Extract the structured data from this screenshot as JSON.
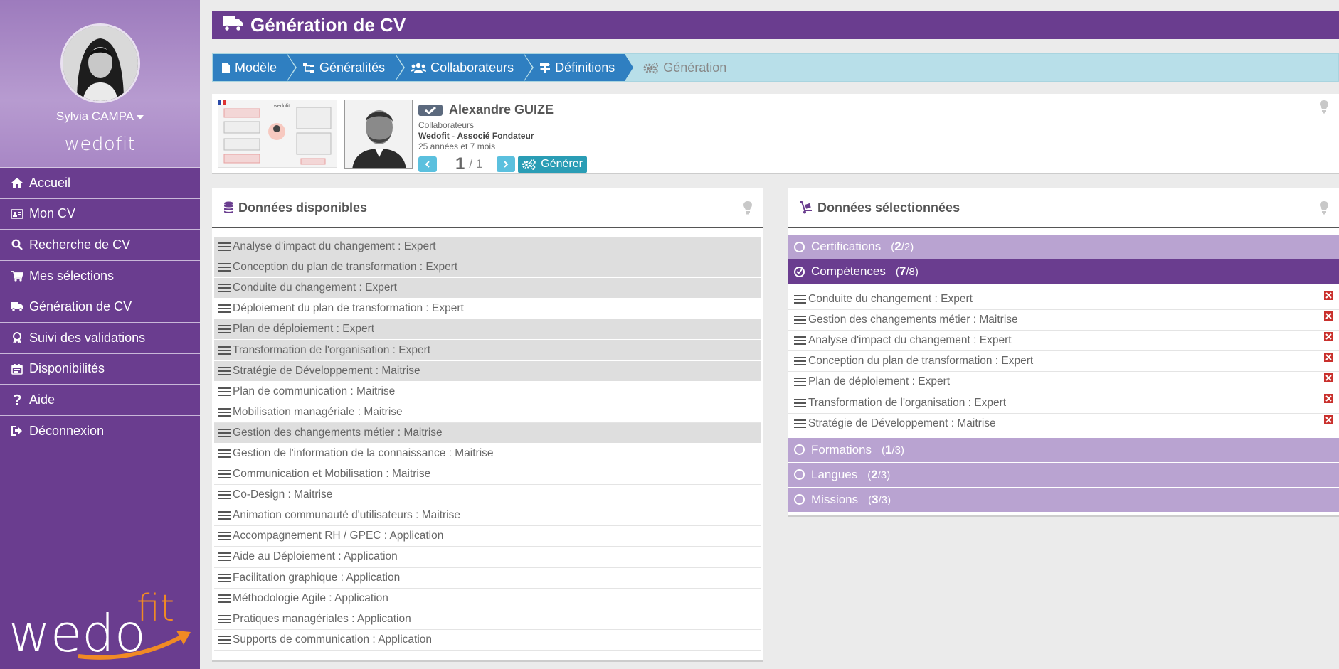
{
  "sidebar": {
    "user_name": "Sylvia CAMPA",
    "small_logo": "wedofit",
    "nav": [
      {
        "label": "Accueil",
        "icon": "home-icon"
      },
      {
        "label": "Mon CV",
        "icon": "id-card-icon"
      },
      {
        "label": "Recherche de CV",
        "icon": "search-icon"
      },
      {
        "label": "Mes sélections",
        "icon": "cart-icon"
      },
      {
        "label": "Génération de CV",
        "icon": "truck-icon"
      },
      {
        "label": "Suivi des validations",
        "icon": "award-icon"
      },
      {
        "label": "Disponibilités",
        "icon": "calendar-icon"
      },
      {
        "label": "Aide",
        "icon": "question-icon"
      },
      {
        "label": "Déconnexion",
        "icon": "sign-out-icon"
      }
    ],
    "logo_left": "wedo",
    "logo_right": "fit"
  },
  "header": {
    "title": "Génération de CV"
  },
  "steps": [
    {
      "label": "Modèle",
      "icon": "file-icon"
    },
    {
      "label": "Généralités",
      "icon": "sitemap-icon"
    },
    {
      "label": "Collaborateurs",
      "icon": "users-icon"
    },
    {
      "label": "Définitions",
      "icon": "signs-icon"
    },
    {
      "label": "Génération",
      "icon": "cogs-icon"
    }
  ],
  "profile": {
    "name": "Alexandre GUIZE",
    "category": "Collaborateurs",
    "company": "Wedofit",
    "separator": " - ",
    "role": "Associé Fondateur",
    "experience": "25 années et 7 mois",
    "page_current": "1",
    "page_total": "/ 1",
    "generate_label": "Générer"
  },
  "available": {
    "title": "Données disponibles",
    "items": [
      {
        "label": "Analyse d'impact du changement : Expert",
        "highlighted": true
      },
      {
        "label": "Conception du plan de transformation : Expert",
        "highlighted": true
      },
      {
        "label": "Conduite du changement : Expert",
        "highlighted": true
      },
      {
        "label": "Déploiement du plan de transformation : Expert",
        "highlighted": false
      },
      {
        "label": "Plan de déploiement : Expert",
        "highlighted": true
      },
      {
        "label": "Transformation de l'organisation : Expert",
        "highlighted": true
      },
      {
        "label": "Stratégie de Développement : Maitrise",
        "highlighted": true
      },
      {
        "label": "Plan de communication : Maitrise",
        "highlighted": false
      },
      {
        "label": "Mobilisation managériale : Maitrise",
        "highlighted": false
      },
      {
        "label": "Gestion des changements métier : Maitrise",
        "highlighted": true
      },
      {
        "label": "Gestion de l'information de la connaissance : Maitrise",
        "highlighted": false
      },
      {
        "label": "Communication et Mobilisation : Maitrise",
        "highlighted": false
      },
      {
        "label": "Co-Design : Maitrise",
        "highlighted": false
      },
      {
        "label": "Animation communauté d'utilisateurs : Maitrise",
        "highlighted": false
      },
      {
        "label": "Accompagnement RH / GPEC : Application",
        "highlighted": false
      },
      {
        "label": "Aide au Déploiement : Application",
        "highlighted": false
      },
      {
        "label": "Facilitation graphique : Application",
        "highlighted": false
      },
      {
        "label": "Méthodologie Agile : Application",
        "highlighted": false
      },
      {
        "label": "Pratiques managériales : Application",
        "highlighted": false
      },
      {
        "label": "Supports de communication : Application",
        "highlighted": false
      }
    ]
  },
  "selected": {
    "title": "Données sélectionnées",
    "sections": {
      "certifications": {
        "label": "Certifications",
        "count": "2",
        "total": "/2"
      },
      "competences": {
        "label": "Compétences",
        "count": "7",
        "total": "/8"
      },
      "formations": {
        "label": "Formations",
        "count": "1",
        "total": "/3"
      },
      "langues": {
        "label": "Langues",
        "count": "2",
        "total": "/3"
      },
      "missions": {
        "label": "Missions",
        "count": "3",
        "total": "/3"
      }
    },
    "competences_items": [
      "Conduite du changement : Expert",
      "Gestion des changements métier : Maitrise",
      "Analyse d'impact du changement : Expert",
      "Conception du plan de transformation : Expert",
      "Plan de déploiement : Expert",
      "Transformation de l'organisation : Expert",
      "Stratégie de Développement : Maitrise"
    ]
  },
  "colors": {
    "brand_purple": "#6a3d8f",
    "light_purple": "#b9a3d1",
    "step_blue": "#2f7fc1",
    "steps_bg": "#b8dfe9",
    "delete_red": "#c9302c",
    "logo_orange": "#f08a24"
  }
}
